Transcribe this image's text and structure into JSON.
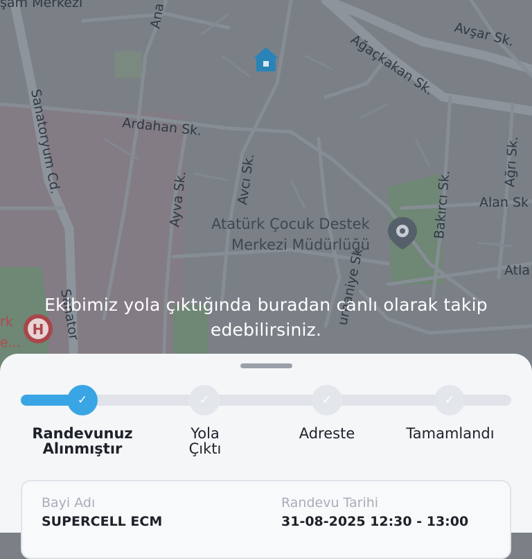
{
  "map": {
    "labels": {
      "merkezi_top": "şam Merkezi",
      "ana": "Ana",
      "avsar": "Avşar Sk.",
      "agacakan": "Ağaçkakan Sk.",
      "sanatoryum": "Sanatoryum Cd.",
      "ardahan": "Ardahan Sk.",
      "avci": "Avcı Sk.",
      "ayva": "Ayva Sk.",
      "bakirci": "Bakırcı Sk.",
      "agri": "Ağrı Sk.",
      "alan": "Alan Sk",
      "atla": "Atla",
      "poi_line1": "Atatürk Çocuk Destek",
      "poi_line2": "Merkezi Müdürlüğü",
      "sanator2": "Sanator",
      "rk": "rk",
      "e_dots": "e...",
      "urhaniye": "urhaniye Sk.",
      "hospital_letter": "H"
    }
  },
  "overlay": {
    "line1": "Ekibimiz yola çıktığında buradan canlı olarak takip",
    "line2": "edebilirsiniz."
  },
  "progress": {
    "fill_fraction": 0.13,
    "steps": [
      {
        "line1": "Randevunuz",
        "line2": "Alınmıştır",
        "state": "active",
        "icon": "check-icon",
        "check": "✓"
      },
      {
        "line1": "Yola",
        "line2": "Çıktı",
        "state": "inactive",
        "icon": "check-icon",
        "check": "✓"
      },
      {
        "line1": "Adreste",
        "line2": "",
        "state": "inactive",
        "icon": "check-icon",
        "check": "✓"
      },
      {
        "line1": "Tamamlandı",
        "line2": "",
        "state": "inactive",
        "icon": "check-icon",
        "check": "✓"
      }
    ]
  },
  "details": {
    "dealer_label": "Bayi Adı",
    "dealer_value": "SUPERCELL ECM",
    "date_label": "Randevu Tarihi",
    "date_value": "31-08-2025 12:30 - 13:00"
  },
  "colors": {
    "accent": "#3aa5e4",
    "map_bg": "#7b8087",
    "sheet_bg": "#f4f6f8"
  }
}
